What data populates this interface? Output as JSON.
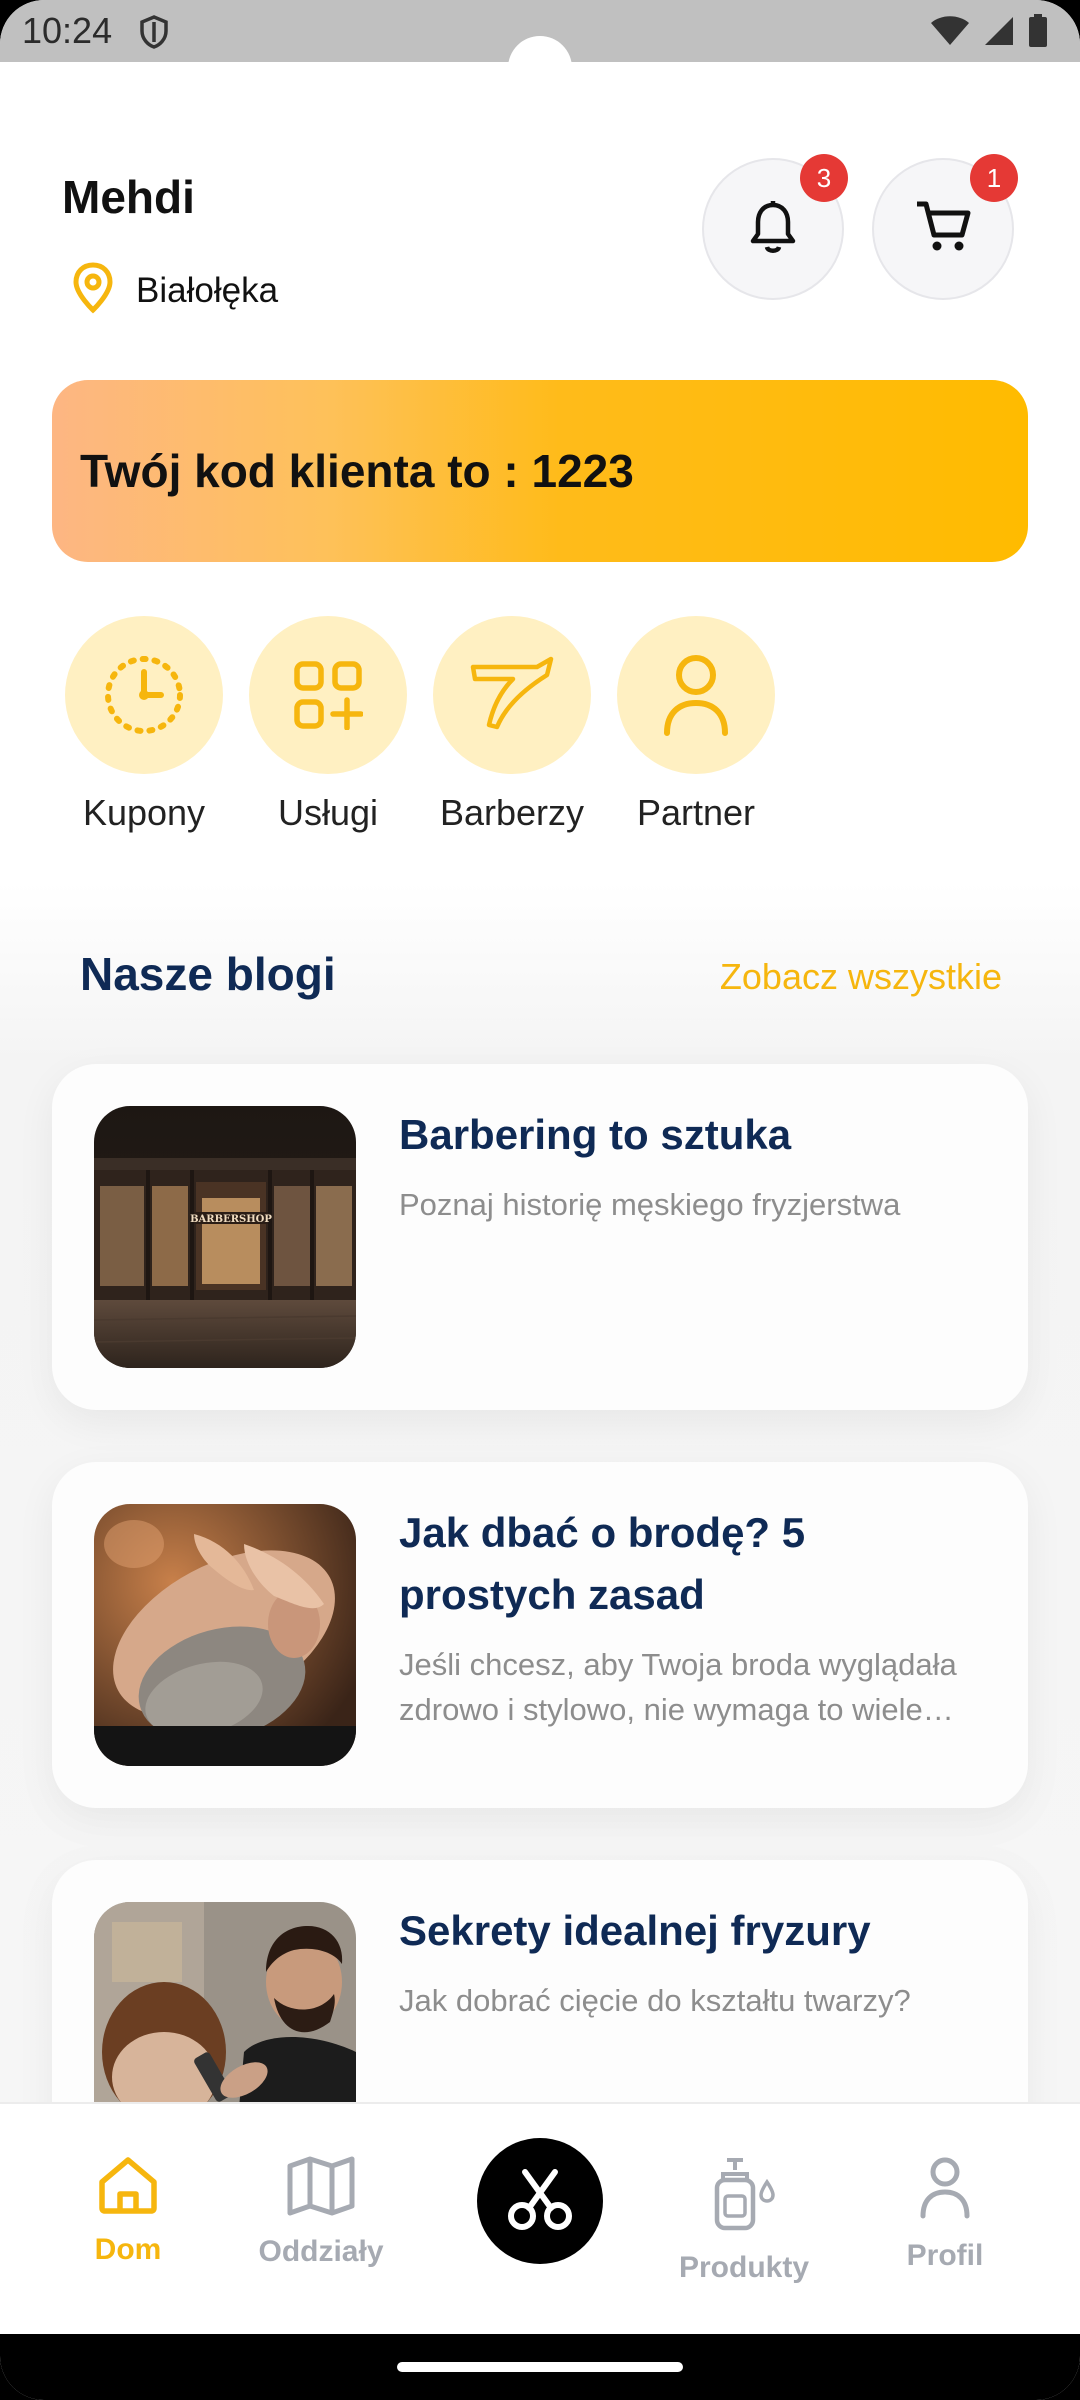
{
  "status_bar": {
    "time": "10:24"
  },
  "header": {
    "user_name": "Mehdi",
    "location": "Białołęka",
    "notifications_count": "3",
    "cart_count": "1"
  },
  "code_card": {
    "text": "Twój kod klienta to : 1223"
  },
  "quick_actions": [
    {
      "label": "Kupony",
      "icon": "clock-icon"
    },
    {
      "label": "Usługi",
      "icon": "apps-add-icon"
    },
    {
      "label": "Barberzy",
      "icon": "razor-icon"
    },
    {
      "label": "Partner",
      "icon": "person-icon"
    }
  ],
  "blogs": {
    "title": "Nasze blogi",
    "see_all": "Zobacz wszystkie",
    "items": [
      {
        "title": "Barbering to sztuka",
        "description": " Poznaj historię męskiego fryzjerstwa",
        "image": "barbershop-storefront-photo",
        "sign_text": "BARBERSHOP"
      },
      {
        "title": " Jak dbać o brodę? 5 prostych zasad",
        "description": "Jeśli chcesz, aby Twoja broda wyglądała zdrowo i stylowo, nie wymaga to wiele wysiłku.",
        "image": "beard-care-photo"
      },
      {
        "title": "Sekrety idealnej fryzury",
        "description": "Jak dobrać cięcie do kształtu twarzy?",
        "image": "haircut-photo"
      }
    ]
  },
  "bottom_nav": {
    "items": [
      {
        "label": "Dom",
        "icon": "home-icon",
        "active": true
      },
      {
        "label": "Oddziały",
        "icon": "map-icon",
        "active": false
      },
      {
        "label": "",
        "icon": "scissors-icon",
        "active": false
      },
      {
        "label": "Produkty",
        "icon": "soap-bottle-icon",
        "active": false
      },
      {
        "label": "Profil",
        "icon": "profile-icon",
        "active": false
      }
    ]
  },
  "colors": {
    "accent": "#f6b60e",
    "title_navy": "#0f2a55",
    "badge_red": "#e53935",
    "quick_bg": "#fff0c2"
  }
}
